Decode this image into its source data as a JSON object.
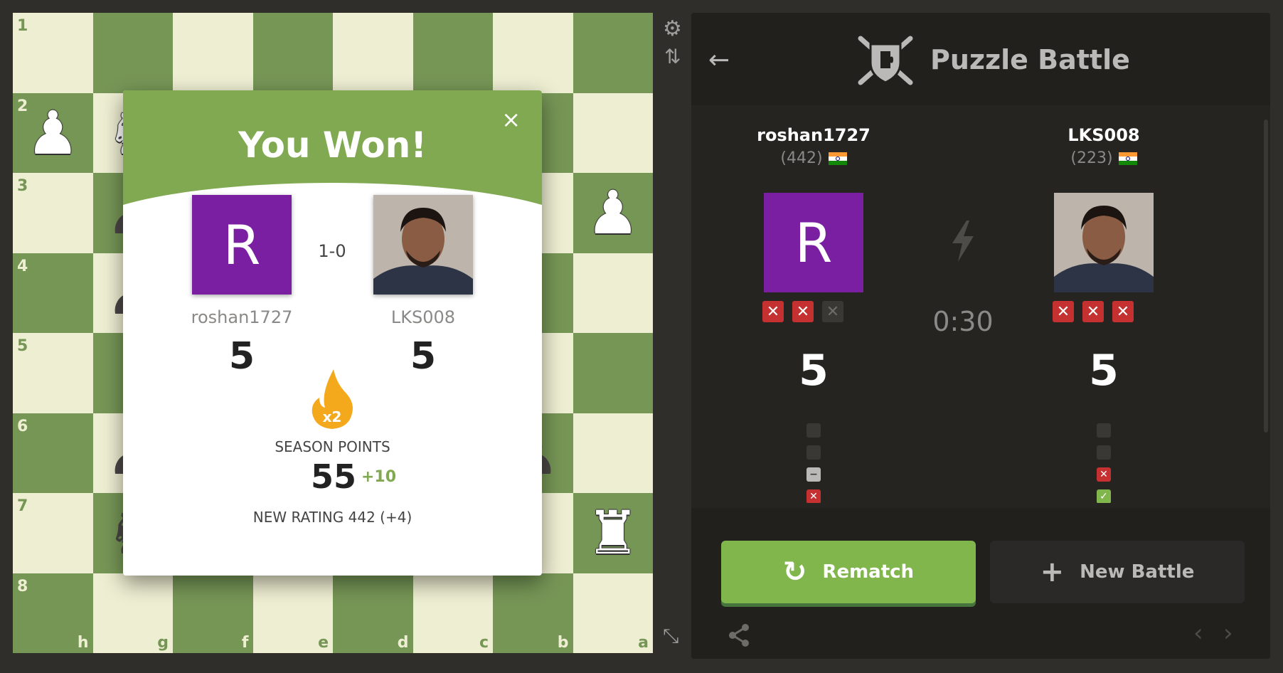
{
  "board": {
    "ranks": [
      "1",
      "2",
      "3",
      "4",
      "5",
      "6",
      "7",
      "8"
    ],
    "files": [
      "h",
      "g",
      "f",
      "e",
      "d",
      "c",
      "b",
      "a"
    ],
    "pieces": [
      {
        "row": 1,
        "col": 0,
        "color": "w",
        "glyph": "♟",
        "name": "white-pawn-icon"
      },
      {
        "row": 1,
        "col": 1,
        "color": "w",
        "glyph": "♞",
        "name": "white-knight-icon"
      },
      {
        "row": 2,
        "col": 1,
        "color": "b",
        "glyph": "♟",
        "name": "black-pawn-icon"
      },
      {
        "row": 2,
        "col": 7,
        "color": "w",
        "glyph": "♟",
        "name": "white-pawn-icon"
      },
      {
        "row": 3,
        "col": 1,
        "color": "b",
        "glyph": "♟",
        "name": "black-pawn-icon"
      },
      {
        "row": 5,
        "col": 1,
        "color": "b",
        "glyph": "♟",
        "name": "black-pawn-icon"
      },
      {
        "row": 5,
        "col": 6,
        "color": "b",
        "glyph": "♟",
        "name": "black-pawn-icon"
      },
      {
        "row": 6,
        "col": 1,
        "color": "b",
        "glyph": "♞",
        "name": "black-knight-icon"
      },
      {
        "row": 6,
        "col": 7,
        "color": "w",
        "glyph": "♜",
        "name": "white-rook-icon"
      }
    ],
    "colors": {
      "light": "#eeeed2",
      "dark": "#769656"
    }
  },
  "side_icons": {
    "settings": "gear-icon",
    "flip": "flip-board-icon",
    "expand": "expand-icon"
  },
  "modal": {
    "title": "You Won!",
    "close": "×",
    "result": "1-0",
    "player1": {
      "name": "roshan1727",
      "initial": "R",
      "score": "5"
    },
    "player2": {
      "name": "LKS008",
      "score": "5"
    },
    "multiplier": "x2",
    "season_label": "SEASON POINTS",
    "season_points": "55",
    "season_delta": "+10",
    "new_rating": "NEW RATING 442 (+4)"
  },
  "panel": {
    "back": "←",
    "title": "Puzzle Battle",
    "player1": {
      "name": "roshan1727",
      "rating": "(442)",
      "initial": "R",
      "score": "5",
      "strikes": [
        "wrong",
        "wrong",
        "off"
      ],
      "results": [
        "empty",
        "empty",
        "skip",
        "wrong",
        "wrong"
      ]
    },
    "player2": {
      "name": "LKS008",
      "rating": "(223)",
      "score": "5",
      "strikes": [
        "wrong",
        "wrong",
        "wrong"
      ],
      "results": [
        "empty",
        "empty",
        "wrong",
        "right",
        "right"
      ]
    },
    "timer": "0:30",
    "rematch_label": "Rematch",
    "new_battle_label": "New Battle",
    "accent": "#81b64c",
    "avatar_color": "#7b1fa2"
  }
}
